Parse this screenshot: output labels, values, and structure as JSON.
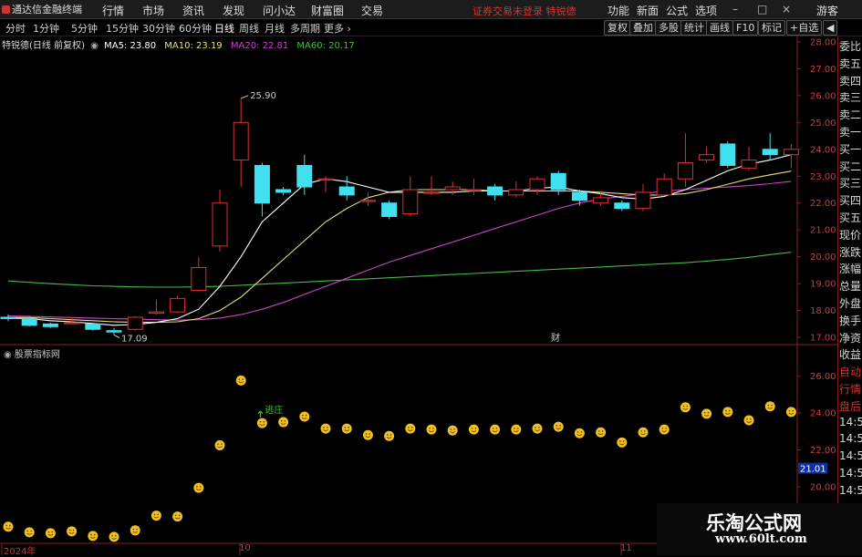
{
  "app_name": "通达信金融终端",
  "menu": [
    "行情",
    "市场",
    "资讯",
    "发现",
    "问小达",
    "财富圈",
    "交易"
  ],
  "notice": "证券交易未登录  特锐德",
  "right_menu": [
    "功能",
    "新面",
    "公式",
    "选项"
  ],
  "window_buttons": [
    "–",
    "□",
    "×"
  ],
  "user_button": "游客",
  "periods": [
    "分时",
    "1分钟",
    "5分钟",
    "15分钟",
    "30分钟",
    "60分钟",
    "日线",
    "周线",
    "月线",
    "多周期",
    "更多 ›"
  ],
  "active_period": "日线",
  "tools": [
    "复权",
    "叠加",
    "多股",
    "统计",
    "画线",
    "F10",
    "标记",
    "+自选",
    "◀"
  ],
  "chart_title": "特锐德(日线 前复权)",
  "ma_legend": [
    {
      "label": "MA5: 23.80",
      "color": "#ffffff"
    },
    {
      "label": "MA10: 23.19",
      "color": "#e8e070"
    },
    {
      "label": "MA20: 22.81",
      "color": "#cc44cc"
    },
    {
      "label": "MA60: 20.17",
      "color": "#44bb44"
    }
  ],
  "colors": {
    "up": "#e03030",
    "down": "#40e0f0",
    "ma5": "#ffffff",
    "ma10": "#e8e070",
    "ma20": "#cc44cc",
    "ma60": "#44bb44",
    "axis": "#cc3c3c",
    "smiley": "#f0c020"
  },
  "main_axis": [
    28.0,
    27.0,
    26.0,
    25.0,
    24.0,
    23.0,
    22.0,
    21.0,
    20.0,
    19.0,
    18.0,
    17.0
  ],
  "high_marker": "25.90",
  "low_marker": "17.09",
  "fin_mark": "财",
  "sub_title": "股票指标网",
  "sub_axis": [
    26.0,
    24.0,
    22.0,
    20.0
  ],
  "sub_current": "21.01",
  "escape_label": "逃庄",
  "side_items": [
    "委比",
    "卖五",
    "卖四",
    "卖三",
    "卖二",
    "卖一",
    "买一",
    "买二",
    "买三",
    "买四",
    "买五",
    "现价",
    "涨跌",
    "涨幅",
    "总量",
    "外盘",
    "换手",
    "净资",
    "收益",
    "自动",
    "行情",
    "盘后",
    "14:50",
    "14:50",
    "14:50",
    "14:50",
    "14:50",
    "14:50",
    "14:50"
  ],
  "dates": [
    "2024年",
    "10",
    "11"
  ],
  "watermark_cn": "乐淘公式网",
  "watermark_url": "www.60lt.com",
  "chart_data": {
    "type": "candlestick",
    "title": "特锐德(日线 前复权)",
    "ylim": [
      16.8,
      28.2
    ],
    "candles": [
      [
        17.75,
        17.7,
        17.85,
        17.6
      ],
      [
        17.7,
        17.45,
        17.8,
        17.4
      ],
      [
        17.5,
        17.4,
        17.55,
        17.35
      ],
      [
        17.55,
        17.55,
        17.75,
        17.5
      ],
      [
        17.5,
        17.3,
        17.55,
        17.25
      ],
      [
        17.25,
        17.2,
        17.35,
        17.09
      ],
      [
        17.3,
        17.75,
        17.8,
        17.25
      ],
      [
        17.9,
        17.95,
        18.4,
        17.85
      ],
      [
        17.95,
        18.45,
        18.55,
        17.9
      ],
      [
        18.75,
        19.6,
        20.0,
        18.7
      ],
      [
        20.4,
        22.0,
        22.5,
        20.2
      ],
      [
        23.6,
        25.0,
        25.9,
        22.6
      ],
      [
        23.4,
        22.0,
        23.5,
        21.5
      ],
      [
        22.5,
        22.4,
        22.6,
        22.3
      ],
      [
        23.4,
        22.6,
        23.8,
        22.3
      ],
      [
        22.9,
        22.9,
        23.0,
        22.4
      ],
      [
        22.6,
        22.3,
        23.0,
        22.1
      ],
      [
        22.1,
        22.1,
        22.4,
        21.9
      ],
      [
        22.0,
        21.5,
        22.1,
        21.4
      ],
      [
        21.6,
        22.5,
        23.0,
        21.5
      ],
      [
        22.4,
        22.4,
        23.0,
        22.3
      ],
      [
        22.5,
        22.6,
        22.8,
        22.3
      ],
      [
        22.5,
        22.5,
        22.9,
        22.3
      ],
      [
        22.6,
        22.3,
        22.7,
        22.1
      ],
      [
        22.3,
        22.5,
        22.8,
        22.2
      ],
      [
        22.5,
        22.9,
        23.0,
        22.3
      ],
      [
        23.1,
        22.5,
        23.2,
        22.3
      ],
      [
        22.4,
        22.1,
        22.5,
        21.9
      ],
      [
        22.0,
        22.2,
        22.4,
        21.9
      ],
      [
        22.0,
        21.8,
        22.1,
        21.7
      ],
      [
        21.8,
        22.4,
        22.7,
        21.7
      ],
      [
        22.3,
        22.9,
        23.1,
        22.3
      ],
      [
        22.9,
        23.5,
        24.6,
        22.6
      ],
      [
        23.6,
        23.8,
        24.1,
        23.5
      ],
      [
        24.2,
        23.4,
        24.3,
        23.3
      ],
      [
        23.3,
        23.6,
        24.1,
        23.2
      ],
      [
        24.0,
        23.8,
        24.6,
        23.6
      ],
      [
        23.8,
        24.0,
        24.2,
        23.3
      ]
    ],
    "ma5": [
      17.72,
      17.7,
      17.62,
      17.58,
      17.52,
      17.45,
      17.48,
      17.56,
      17.7,
      18.05,
      18.9,
      20.0,
      21.3,
      22.0,
      22.7,
      22.9,
      22.8,
      22.6,
      22.4,
      22.4,
      22.4,
      22.4,
      22.45,
      22.45,
      22.45,
      22.55,
      22.6,
      22.45,
      22.35,
      22.2,
      22.15,
      22.25,
      22.5,
      22.85,
      23.2,
      23.45,
      23.6,
      23.8
    ],
    "ma10": [
      17.75,
      17.74,
      17.7,
      17.66,
      17.62,
      17.58,
      17.56,
      17.56,
      17.58,
      17.7,
      18.0,
      18.5,
      19.2,
      19.9,
      20.6,
      21.3,
      21.8,
      22.2,
      22.4,
      22.5,
      22.5,
      22.5,
      22.5,
      22.45,
      22.45,
      22.45,
      22.45,
      22.45,
      22.4,
      22.35,
      22.3,
      22.3,
      22.35,
      22.5,
      22.7,
      22.9,
      23.05,
      23.19
    ],
    "ma20": [
      17.8,
      17.78,
      17.76,
      17.74,
      17.72,
      17.7,
      17.68,
      17.66,
      17.64,
      17.66,
      17.72,
      17.85,
      18.05,
      18.3,
      18.6,
      18.9,
      19.2,
      19.5,
      19.8,
      20.05,
      20.3,
      20.55,
      20.8,
      21.05,
      21.3,
      21.55,
      21.8,
      22.0,
      22.15,
      22.25,
      22.35,
      22.45,
      22.5,
      22.55,
      22.6,
      22.65,
      22.72,
      22.81
    ],
    "ma60": [
      19.1,
      19.05,
      19.0,
      18.96,
      18.92,
      18.9,
      18.88,
      18.87,
      18.87,
      18.88,
      18.9,
      18.94,
      18.98,
      19.02,
      19.06,
      19.1,
      19.14,
      19.18,
      19.22,
      19.26,
      19.3,
      19.34,
      19.38,
      19.42,
      19.46,
      19.5,
      19.54,
      19.58,
      19.62,
      19.66,
      19.7,
      19.74,
      19.78,
      19.84,
      19.9,
      19.98,
      20.08,
      20.17
    ],
    "sub_indicator": {
      "name": "股票指标网",
      "ylim": [
        17.0,
        27.0
      ],
      "values": [
        17.85,
        17.55,
        17.5,
        17.6,
        17.35,
        17.3,
        17.65,
        18.45,
        18.4,
        19.95,
        22.25,
        25.75,
        23.45,
        23.5,
        23.8,
        23.15,
        23.15,
        22.8,
        22.75,
        23.15,
        23.1,
        23.05,
        23.1,
        23.1,
        23.1,
        23.15,
        23.25,
        22.9,
        22.95,
        22.4,
        22.95,
        23.1,
        24.3,
        23.95,
        24.05,
        23.6,
        24.35,
        24.05
      ]
    }
  }
}
